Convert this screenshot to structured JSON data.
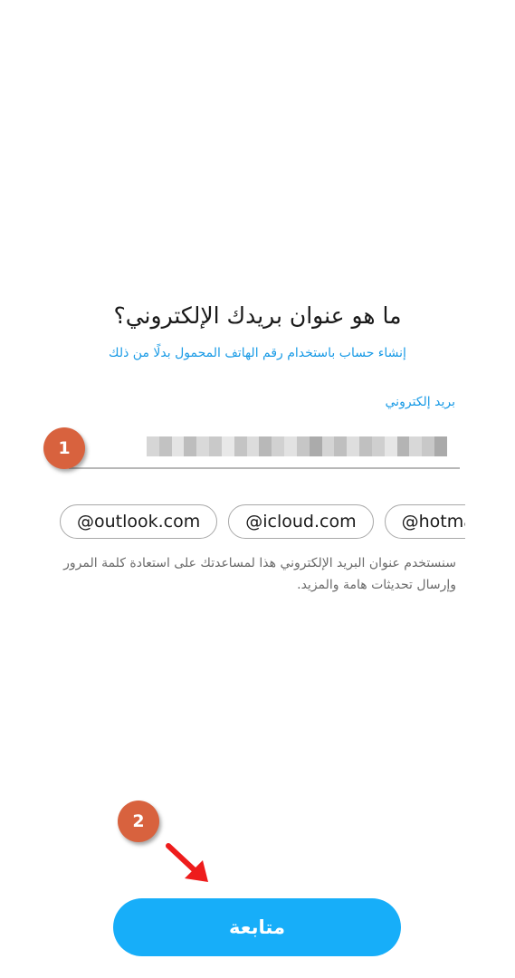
{
  "screen": {
    "title": "ما هو عنوان بريدك الإلكتروني؟",
    "phone_signup_link": "إنشاء حساب باستخدام رقم الهاتف المحمول بدلًا من ذلك",
    "email_field": {
      "label": "بريد إلكتروني",
      "value": "",
      "redacted": true
    },
    "domain_suggestions": [
      "@outlook.com",
      "@icloud.com",
      "@hotmail.com"
    ],
    "helper_text": "سنستخدم عنوان البريد الإلكتروني هذا لمساعدتك على استعادة كلمة المرور وإرسال تحديثات هامة والمزيد.",
    "continue_button_label": "متابعة"
  },
  "annotations": {
    "step_1": "1",
    "step_2": "2"
  },
  "colors": {
    "accent": "#17aef9",
    "link": "#1a9be6",
    "badge": "#d8623e",
    "arrow": "#ee1c1c"
  }
}
